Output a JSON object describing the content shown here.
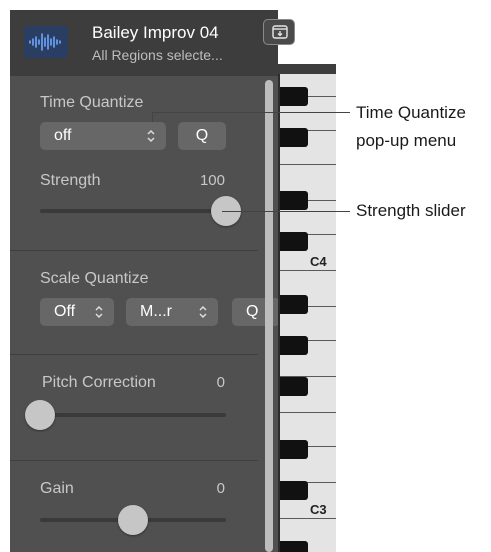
{
  "header": {
    "region_name": "Bailey Improv 04",
    "region_subtitle": "All Regions selecte...",
    "region_icon": "waveform-icon",
    "expand_icon": "tray-download-icon"
  },
  "time_quantize": {
    "label": "Time Quantize",
    "value": "off",
    "button": "Q",
    "strength_label": "Strength",
    "strength_value": "100",
    "strength_fraction": 1.0
  },
  "scale_quantize": {
    "label": "Scale Quantize",
    "value": "Off",
    "scale_value": "M...r",
    "button": "Q"
  },
  "pitch_correction": {
    "label": "Pitch Correction",
    "value": "0",
    "fraction": 0.0
  },
  "gain": {
    "label": "Gain",
    "value": "0",
    "fraction": 0.5
  },
  "keyboard": {
    "labels": [
      "C4",
      "C3"
    ]
  },
  "callouts": {
    "time_quantize": [
      "Time Quantize",
      "pop-up menu"
    ],
    "strength": "Strength slider"
  },
  "colors": {
    "panel": "#505050",
    "header": "#3d3d3d",
    "control": "#676767",
    "region_icon": "#2a3d63"
  }
}
